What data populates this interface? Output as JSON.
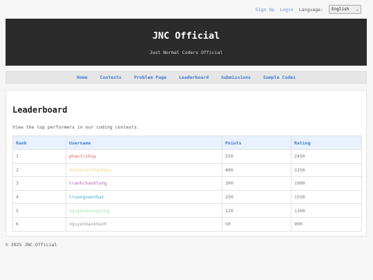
{
  "topbar": {
    "sign_up": "Sign Up",
    "login": "Login",
    "language_label": "Language:",
    "language_selected": "English"
  },
  "header": {
    "title": "JNC Official",
    "subtitle": "Just Normal Coders Official"
  },
  "nav": {
    "items": [
      "Home",
      "Contests",
      "Problem Page",
      "Leaderboard",
      "Submissions",
      "Sample Codes"
    ]
  },
  "leaderboard": {
    "title": "Leaderboard",
    "description": "View the top performers in our coding contests.",
    "columns": [
      "Rank",
      "Username",
      "Points",
      "Rating"
    ],
    "rows": [
      {
        "rank": "1",
        "username": "phantrihuy",
        "points": "550",
        "rating": "2450",
        "color": "#e0624a"
      },
      {
        "rank": "2",
        "username": "dinhvietthanhduc",
        "points": "480",
        "rating": "2250",
        "color": "#f2d27a"
      },
      {
        "rank": "3",
        "username": "tranhchanhlong",
        "points": "300",
        "rating": "1900",
        "color": "#b05fa8"
      },
      {
        "rank": "4",
        "username": "truongvannhat",
        "points": "250",
        "rating": "1550",
        "color": "#3aa8b5"
      },
      {
        "rank": "5",
        "username": "nguyenhoangtung",
        "points": "120",
        "rating": "1200",
        "color": "#a8e0a8"
      },
      {
        "rank": "6",
        "username": "nguyenbaokhanh",
        "points": "50",
        "rating": "900",
        "color": "#999999"
      }
    ]
  },
  "footer": {
    "text": "© 2025 JNC Official"
  }
}
